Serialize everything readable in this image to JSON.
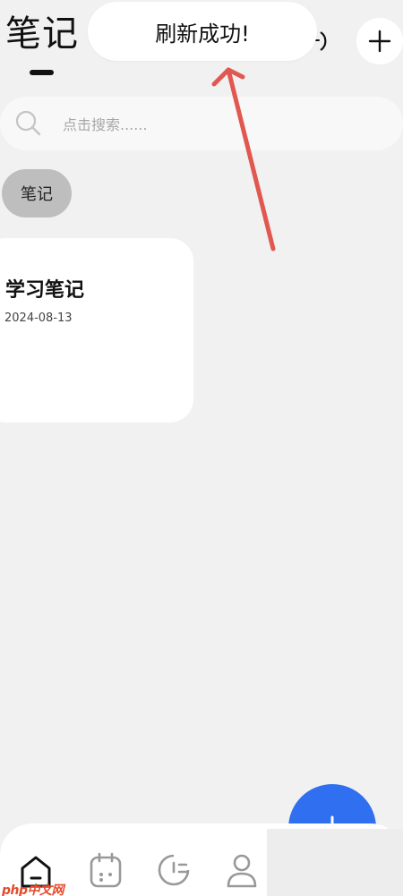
{
  "header": {
    "title": "笔记",
    "add_icon": "plus-icon",
    "partial_icon": "clock-icon"
  },
  "toast": {
    "text": "刷新成功!"
  },
  "search": {
    "placeholder": "点击搜索......",
    "icon": "search-icon"
  },
  "category_chip": {
    "label": "笔记"
  },
  "notes": [
    {
      "title": "学习笔记",
      "date": "2024-08-13"
    }
  ],
  "fab": {
    "icon": "plus-icon",
    "color": "#2f6ff0"
  },
  "bottom_nav": {
    "items": [
      {
        "icon": "home-icon",
        "active": true
      },
      {
        "icon": "calendar-icon",
        "active": false
      },
      {
        "icon": "stats-icon",
        "active": false
      },
      {
        "icon": "profile-icon",
        "active": false
      }
    ]
  },
  "annotation": {
    "arrow_color": "#e0584f"
  },
  "watermark": {
    "text": "php中文网"
  },
  "colors": {
    "background": "#f1f1f1",
    "card": "#ffffff",
    "chip": "#bebebe",
    "accent": "#2f6ff0"
  }
}
